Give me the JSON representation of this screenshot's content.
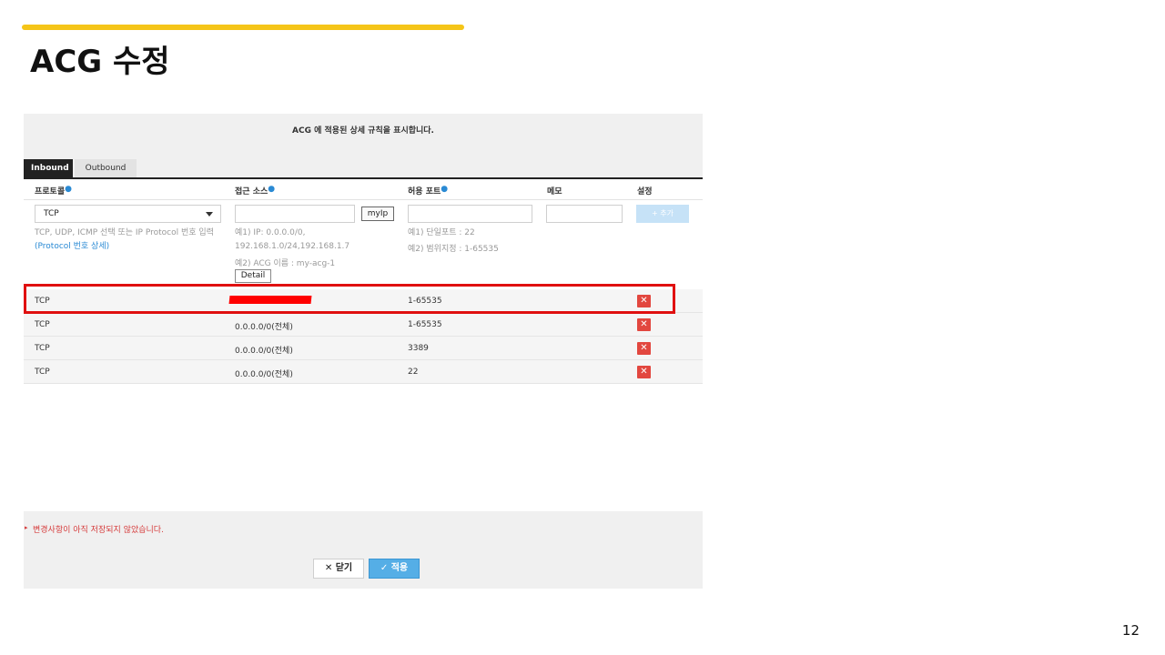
{
  "slide": {
    "title": "ACG 수정",
    "page_number": "12",
    "accent_color": "#f5c518"
  },
  "dialog": {
    "description": "ACG 에 적용된 상세 규칙을 표시합니다.",
    "tabs": [
      {
        "label": "Inbound",
        "active": true
      },
      {
        "label": "Outbound",
        "active": false
      }
    ],
    "columns": {
      "protocol": "프로토콜",
      "source": "접근 소스",
      "port": "허용 포트",
      "memo": "메모",
      "settings": "설정"
    },
    "form": {
      "protocol_selected": "TCP",
      "protocol_hint": "TCP, UDP, ICMP 선택 또는 IP Protocol 번호 입력",
      "protocol_link": "(Protocol 번호 상세)",
      "myip_button": "myIp",
      "source_hint_1": "예1) IP: 0.0.0.0/0,",
      "source_hint_2": "192.168.1.0/24,192.168.1.7",
      "source_hint_3": "예2) ACG 이름 : my-acg-1",
      "detail_button": "Detail",
      "port_hint_1": "예1) 단일포트 : 22",
      "port_hint_2": "예2) 범위지정 : 1-65535",
      "add_button": "+ 추가"
    },
    "rules": [
      {
        "protocol": "TCP",
        "source": "",
        "source_redacted": true,
        "port": "1-65535",
        "memo": "",
        "highlighted": true
      },
      {
        "protocol": "TCP",
        "source": "0.0.0.0/0(전체)",
        "source_redacted": false,
        "port": "1-65535",
        "memo": "",
        "highlighted": false
      },
      {
        "protocol": "TCP",
        "source": "0.0.0.0/0(전체)",
        "source_redacted": false,
        "port": "3389",
        "memo": "",
        "highlighted": false
      },
      {
        "protocol": "TCP",
        "source": "0.0.0.0/0(전체)",
        "source_redacted": false,
        "port": "22",
        "memo": "",
        "highlighted": false
      }
    ],
    "delete_icon": "close-x-icon",
    "delete_color": "#e2473f",
    "footer": {
      "unsaved_notice": "변경사항이 아직 저장되지 않았습니다.",
      "close_button": "✕ 닫기",
      "apply_button": "✓ 적용"
    }
  },
  "annotation": {
    "highlight_color": "#e01010",
    "redaction_color": "#ff0000"
  }
}
